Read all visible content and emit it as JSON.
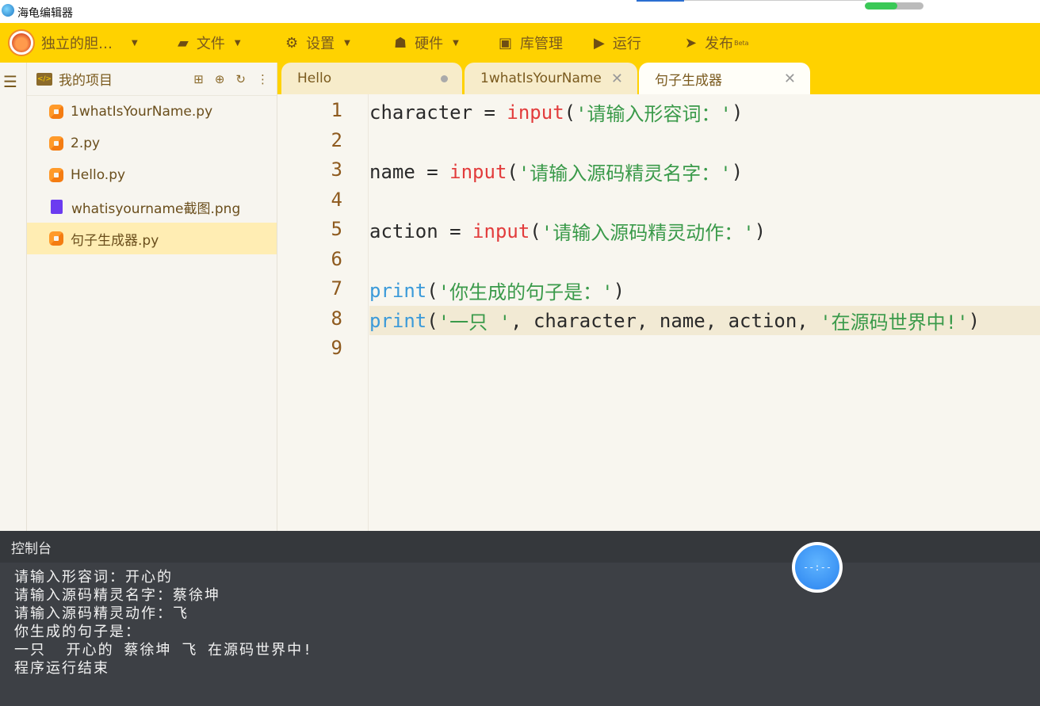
{
  "window": {
    "title": "海龟编辑器",
    "progress_fraction": 0.55
  },
  "menubar": {
    "user": "独立的胆…",
    "items": [
      {
        "label": "文件",
        "icon": "folder-icon"
      },
      {
        "label": "设置",
        "icon": "gear-icon"
      },
      {
        "label": "硬件",
        "icon": "hardware-icon"
      },
      {
        "label": "库管理",
        "icon": "library-icon"
      },
      {
        "label": "运行",
        "icon": "play-icon"
      },
      {
        "label": "发布",
        "icon": "paper-plane-icon",
        "badge": "Beta"
      }
    ]
  },
  "explorer": {
    "title": "我的项目",
    "files": [
      {
        "name": "1whatIsYourName.py",
        "type": "py"
      },
      {
        "name": "2.py",
        "type": "py"
      },
      {
        "name": "Hello.py",
        "type": "py"
      },
      {
        "name": "whatisyourname截图.png",
        "type": "png"
      },
      {
        "name": "句子生成器.py",
        "type": "py",
        "selected": true
      }
    ]
  },
  "tabs": [
    {
      "label": "Hello",
      "state": "modified"
    },
    {
      "label": "1whatIsYourName",
      "state": "closable"
    },
    {
      "label": "句子生成器",
      "state": "active"
    }
  ],
  "editor": {
    "line_numbers": [
      "1",
      "2",
      "3",
      "4",
      "5",
      "6",
      "7",
      "8",
      "9"
    ],
    "code": {
      "l1_var": "character = ",
      "l1_fn": "input",
      "l1_open": "(",
      "l1_str": "'请输入形容词：'",
      "l1_close": ")",
      "l3_var": "name = ",
      "l3_fn": "input",
      "l3_open": "(",
      "l3_str": "'请输入源码精灵名字：'",
      "l3_close": ")",
      "l5_var": "action = ",
      "l5_fn": "input",
      "l5_open": "(",
      "l5_str": "'请输入源码精灵动作：'",
      "l5_close": ")",
      "l7_fn": "print",
      "l7_open": "(",
      "l7_str": "'你生成的句子是：'",
      "l7_close": ")",
      "l8_fn": "print",
      "l8_open": "(",
      "l8_str1": "'一只 '",
      "l8_mid": ", character, name, action, ",
      "l8_str2": "'在源码世界中!'",
      "l8_close": ")"
    }
  },
  "console": {
    "title": "控制台",
    "lines": [
      "请输入形容词：开心的",
      "请输入源码精灵名字：蔡徐坤",
      "请输入源码精灵动作：飞",
      "你生成的句子是：",
      "一只  开心的 蔡徐坤 飞 在源码世界中!",
      "程序运行结束"
    ],
    "timer": "--:--"
  }
}
